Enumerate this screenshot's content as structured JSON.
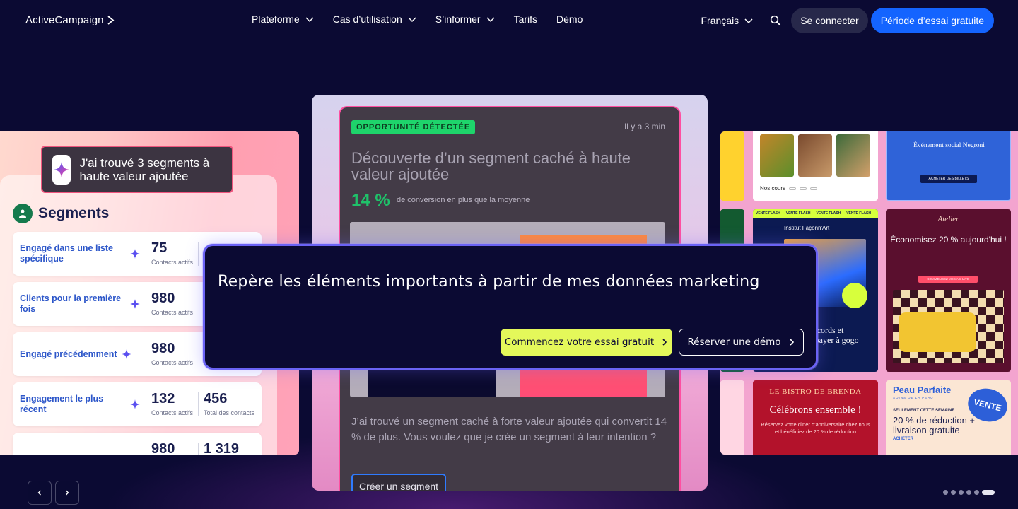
{
  "nav": {
    "logo": "ActiveCampaign",
    "links": [
      "Plateforme",
      "Cas d’utilisation",
      "S’informer",
      "Tarifs",
      "Démo"
    ],
    "language": "Français",
    "login": "Se connecter",
    "trial": "Période d’essai gratuite"
  },
  "left": {
    "found": "J'ai trouvé 3 segments à haute valeur ajoutée",
    "title": "Segments",
    "rows": [
      {
        "name": "Engagé dans une liste spécifique",
        "n1": "75",
        "l1": "Contacts actifs",
        "n2": "",
        "l2": ""
      },
      {
        "name": "Clients pour la première fois",
        "n1": "980",
        "l1": "Contacts actifs",
        "n2": "",
        "l2": ""
      },
      {
        "name": "Engagé précédemment",
        "n1": "980",
        "l1": "Contacts actifs",
        "n2": "",
        "l2": ""
      },
      {
        "name": "Engagement le plus récent",
        "n1": "132",
        "l1": "Contacts actifs",
        "n2": "456",
        "l2": "Total des contacts"
      },
      {
        "name": "",
        "n1": "980",
        "l1": "",
        "n2": "1 319",
        "l2": ""
      }
    ]
  },
  "center": {
    "badge": "OPPORTUNITÉ DÉTECTÉE",
    "time": "Il y a 3 min",
    "title": "Découverte d’un segment caché à haute valeur ajoutée",
    "pct": "14 %",
    "pct_label": "de conversion en plus que la moyenne",
    "body": "J’ai trouvé un segment caché à forte valeur ajoutée qui convertit 14 % de plus. Vous voulez que je crée un segment à leur intention ?",
    "button": "Créer un segment"
  },
  "right": {
    "food_nav": "Nos cours",
    "flash_strip": [
      "VENTE FLASH",
      "VENTE FLASH",
      "VENTE FLASH",
      "VENTE FLASH"
    ],
    "flash_brand": "Institut Façonn'Art",
    "flash_sticker": "",
    "flash_text": "accords et\ns payer à gogo",
    "bistro_head": "LE BISTRO DE BRENDA",
    "bistro_title": "Célébrons ensemble !",
    "bistro_sub": "Réservez votre dîner d'anniversaire chez nous et bénéficiez de 20 % de réduction",
    "negroni_title": "Événement social Negroni",
    "negroni_btn": "ACHETER DES BILLETS",
    "atelier_logo": "Atelier",
    "atelier_title": "Économisez 20 % aujourd'hui !",
    "atelier_btn": "COMMENCEZ MES ACHATS",
    "peau_title": "Peau Parfaite",
    "peau_sub": "SOINS DE LA PEAU",
    "peau_burst": "VENTE",
    "peau_small": "SEULEMENT CETTE SEMAINE",
    "peau_big": "20 % de réduction + livraison gratuite",
    "peau_buy": "ACHETER"
  },
  "prompt": {
    "text": "Repère les éléments importants à partir de mes données marketing",
    "cta_trial": "Commencez votre essai gratuit",
    "cta_demo": "Réserver une démo"
  },
  "carousel": {
    "slides": 6,
    "active": 6
  },
  "colors": {
    "bg": "#0b0a33",
    "accent_blue": "#1464ff",
    "accent_lime": "#e4f85a",
    "badge_green": "#1ed46b"
  }
}
